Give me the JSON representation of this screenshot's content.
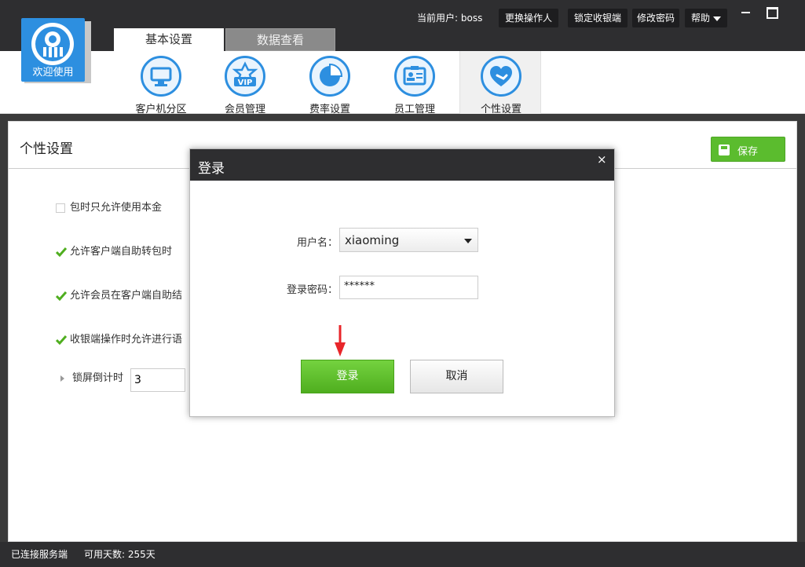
{
  "header": {
    "logo_text": "欢迎使用",
    "tabs": [
      {
        "label": "基本设置",
        "active": true
      },
      {
        "label": "数据查看",
        "active": false
      }
    ],
    "user_label": "当前用户: boss",
    "buttons": {
      "switch_operator": "更换操作人",
      "lock_cashier": "锁定收银端",
      "change_password": "修改密码",
      "help": "帮助"
    }
  },
  "toolbar": {
    "items": [
      {
        "label": "客户机分区",
        "icon": "monitor-icon"
      },
      {
        "label": "会员管理",
        "icon": "vip-icon"
      },
      {
        "label": "费率设置",
        "icon": "pie-chart-icon"
      },
      {
        "label": "员工管理",
        "icon": "id-card-icon"
      },
      {
        "label": "个性设置",
        "icon": "heart-wrench-icon",
        "active": true
      }
    ]
  },
  "main": {
    "title": "个性设置",
    "save_label": "保存",
    "options": [
      {
        "label": "包时只允许使用本金",
        "checked": false
      },
      {
        "label": "允许客户端自助转包时",
        "checked": true
      },
      {
        "label": "允许会员在客户端自助结",
        "checked": true
      },
      {
        "label": "收银端操作时允许进行语",
        "checked": true
      }
    ],
    "lock_timer_label": "锁屏倒计时",
    "lock_timer_value": "3"
  },
  "dialog": {
    "title": "登录",
    "close": "×",
    "username_label": "用户名：",
    "username_value": "xiaoming",
    "password_label": "登录密码：",
    "password_value": "******",
    "login_label": "登录",
    "cancel_label": "取消"
  },
  "status": {
    "connection": "已连接服务端",
    "days": "可用天数: 255天"
  },
  "colors": {
    "accent_blue": "#2d8fe0",
    "green": "#5bbc2e",
    "dark": "#2e2e30",
    "arrow_red": "#e8262a"
  }
}
